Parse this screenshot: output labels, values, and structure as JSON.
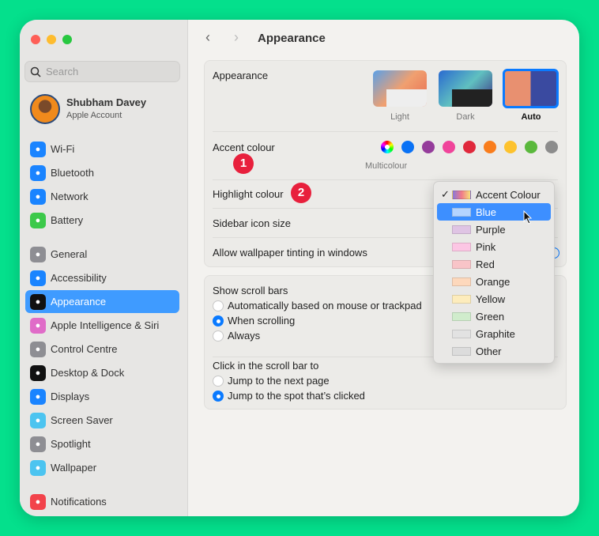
{
  "window": {
    "title": "Appearance"
  },
  "sidebar": {
    "search_placeholder": "Search",
    "user": {
      "name": "Shubham Davey",
      "subtitle": "Apple Account"
    },
    "items": [
      {
        "label": "Wi-Fi",
        "icon": "wifi-icon",
        "color": "#1a84ff"
      },
      {
        "label": "Bluetooth",
        "icon": "bluetooth-icon",
        "color": "#1a84ff"
      },
      {
        "label": "Network",
        "icon": "globe-icon",
        "color": "#1a84ff"
      },
      {
        "label": "Battery",
        "icon": "battery-icon",
        "color": "#3cc94a"
      },
      {
        "label": "General",
        "icon": "gear-icon",
        "color": "#8e8e93"
      },
      {
        "label": "Accessibility",
        "icon": "accessibility-icon",
        "color": "#1a84ff"
      },
      {
        "label": "Appearance",
        "icon": "appearance-icon",
        "color": "#111111",
        "selected": true
      },
      {
        "label": "Apple Intelligence & Siri",
        "icon": "siri-icon",
        "color": "#e06cc8"
      },
      {
        "label": "Control Centre",
        "icon": "control-centre-icon",
        "color": "#8e8e93"
      },
      {
        "label": "Desktop & Dock",
        "icon": "dock-icon",
        "color": "#111111"
      },
      {
        "label": "Displays",
        "icon": "sun-icon",
        "color": "#1a84ff"
      },
      {
        "label": "Screen Saver",
        "icon": "screen-saver-icon",
        "color": "#4cc4f0"
      },
      {
        "label": "Spotlight",
        "icon": "magnifier-icon",
        "color": "#8e8e93"
      },
      {
        "label": "Wallpaper",
        "icon": "flower-icon",
        "color": "#4cc4f0"
      },
      {
        "label": "Notifications",
        "icon": "bell-icon",
        "color": "#f2434b"
      }
    ]
  },
  "appearance": {
    "label": "Appearance",
    "options": [
      {
        "label": "Light"
      },
      {
        "label": "Dark"
      },
      {
        "label": "Auto",
        "selected": true
      }
    ]
  },
  "accent": {
    "label": "Accent colour",
    "selected_label": "Multicolour",
    "colors": [
      "multicolour",
      "#0a72f5",
      "#953c9b",
      "#f0449a",
      "#e0283c",
      "#f97d1c",
      "#fdc22d",
      "#5ab83c",
      "#8c8c8c"
    ]
  },
  "highlight": {
    "label": "Highlight colour"
  },
  "sidebar_icon_size": {
    "label": "Sidebar icon size"
  },
  "tinting": {
    "label": "Allow wallpaper tinting in windows"
  },
  "scroll_bars": {
    "label": "Show scroll bars",
    "options": [
      {
        "label": "Automatically based on mouse or trackpad"
      },
      {
        "label": "When scrolling",
        "selected": true
      },
      {
        "label": "Always"
      }
    ]
  },
  "click_scroll": {
    "label": "Click in the scroll bar to",
    "options": [
      {
        "label": "Jump to the next page"
      },
      {
        "label": "Jump to the spot that’s clicked",
        "selected": true
      }
    ]
  },
  "markers": [
    "1",
    "2"
  ],
  "highlight_menu": {
    "items": [
      {
        "label": "Accent Colour",
        "swatch": "linear-gradient(90deg,#8a7ad8,#f07a8a,#f8e07a)",
        "checked": true
      },
      {
        "label": "Blue",
        "swatch": "#b4d4ff",
        "hovered": true
      },
      {
        "label": "Purple",
        "swatch": "#dfc4e4"
      },
      {
        "label": "Pink",
        "swatch": "#fcc6e4"
      },
      {
        "label": "Red",
        "swatch": "#f8c4c8"
      },
      {
        "label": "Orange",
        "swatch": "#fdd8bc"
      },
      {
        "label": "Yellow",
        "swatch": "#fdecbc"
      },
      {
        "label": "Green",
        "swatch": "#d0eccc"
      },
      {
        "label": "Graphite",
        "swatch": "#e2e2e2"
      },
      {
        "label": "Other",
        "swatch": "#dcdcdc"
      }
    ]
  },
  "help": "?"
}
